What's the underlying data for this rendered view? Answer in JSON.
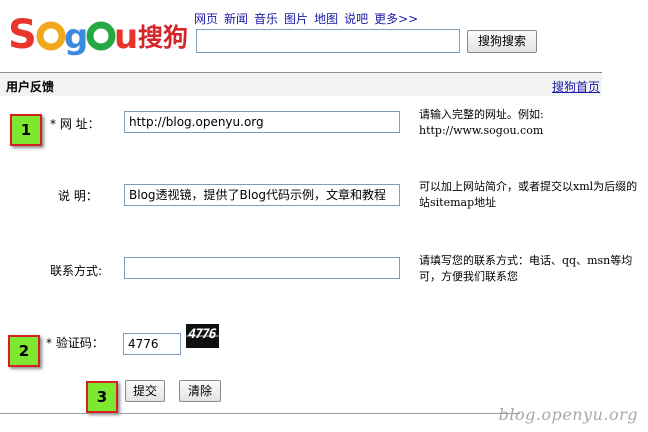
{
  "header": {
    "logo_text": "Sogou搜狗",
    "nav": [
      "网页",
      "新闻",
      "音乐",
      "图片",
      "地图",
      "说吧",
      "更多>>"
    ],
    "search_value": "",
    "search_button": "搜狗搜索"
  },
  "section": {
    "title": "用户反馈",
    "home_link": "搜狗首页"
  },
  "form": {
    "url_label": "* 网  址：",
    "url_value": "http://blog.openyu.org",
    "url_hint_line1": "请输入完整的网址。例如:",
    "url_hint_line2": "http://www.sogou.com",
    "desc_label": "说  明：",
    "desc_value": "Blog透视镜，提供了Blog代码示例，文章和教程",
    "desc_hint_line1": "可以加上网站简介，或者提交以xml为后缀的",
    "desc_hint_line2": "站sitemap地址",
    "contact_label": "联系方式:",
    "contact_value": "",
    "contact_hint_line1": "请填写您的联系方式：电话、qq、msn等均",
    "contact_hint_line2": "可，方便我们联系您",
    "captcha_label": "* 验证码：",
    "captcha_value": "4776",
    "captcha_image_text": "4776",
    "submit_label": "提交",
    "clear_label": "清除"
  },
  "markers": [
    "1",
    "2",
    "3"
  ],
  "watermark": "blog.openyu.org",
  "colors": {
    "marker_fill": "#7ee830",
    "marker_border": "#d42020",
    "link": "#1a1aa6"
  }
}
